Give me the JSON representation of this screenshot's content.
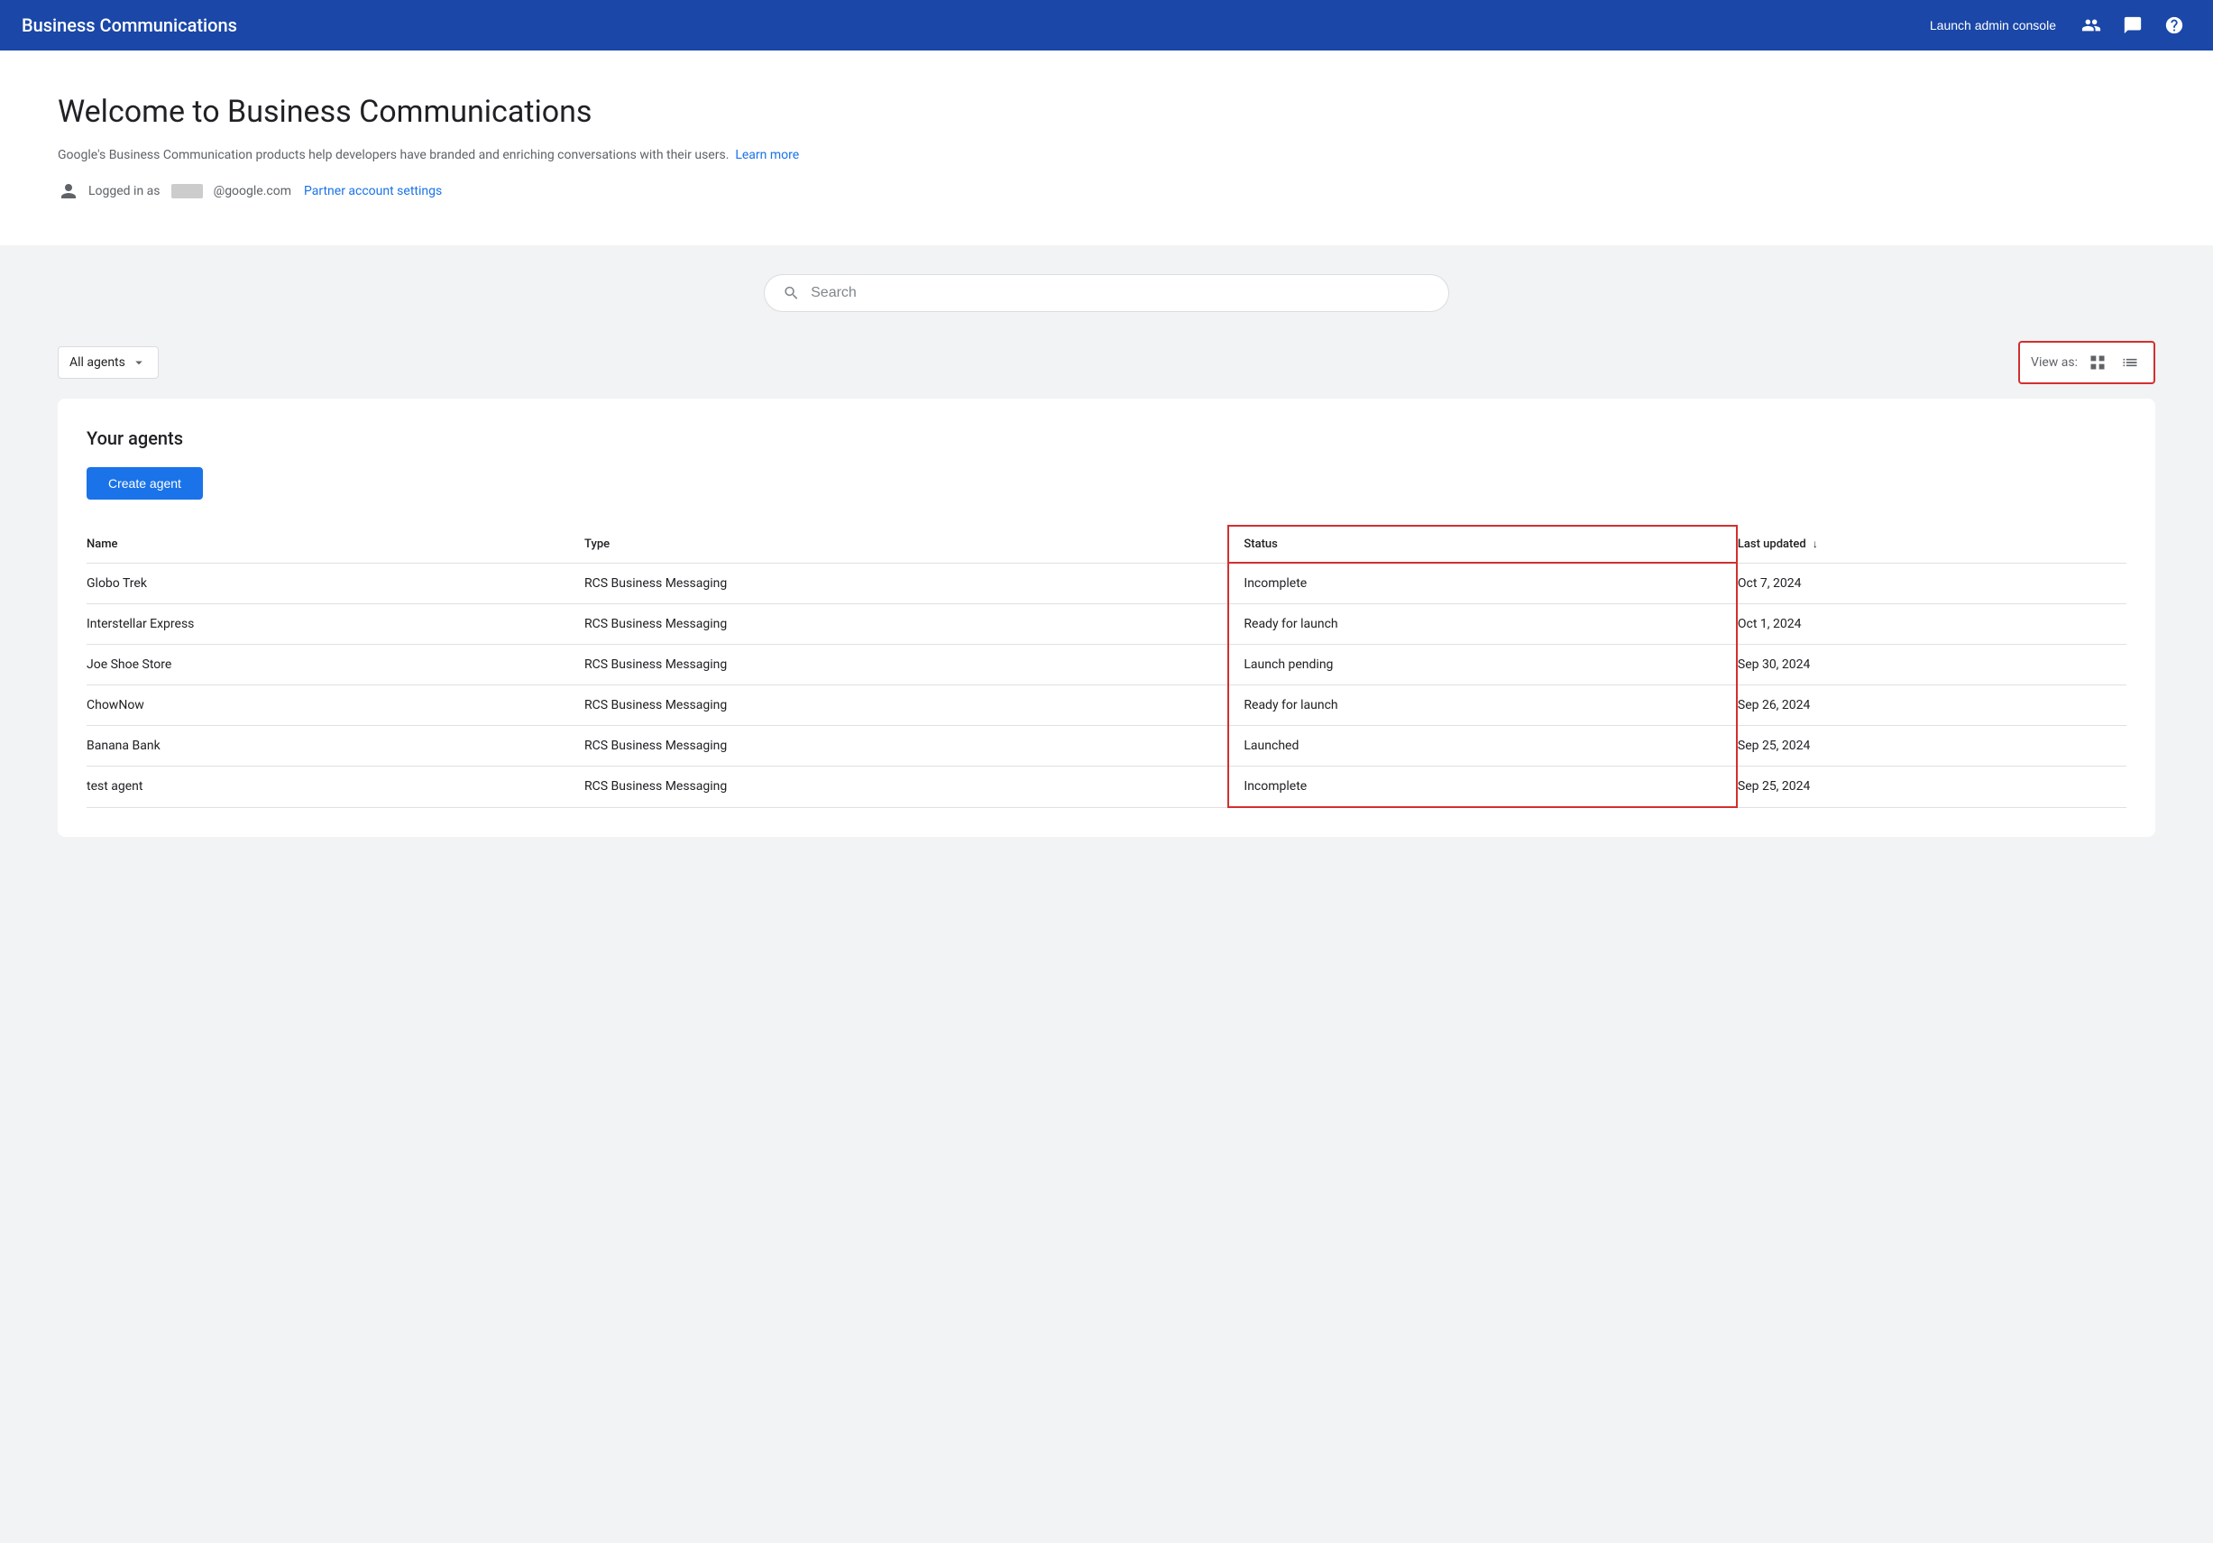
{
  "header": {
    "title": "Business Communications",
    "launch_btn": "Launch admin console",
    "icons": {
      "people": "👥",
      "chat": "💬",
      "help": "?"
    }
  },
  "welcome": {
    "title": "Welcome to Business Communications",
    "description": "Google's Business Communication products help developers have branded and enriching conversations with their users.",
    "learn_more": "Learn more",
    "logged_in_prefix": "Logged in as",
    "email_domain": "@google.com",
    "partner_settings": "Partner account settings"
  },
  "search": {
    "placeholder": "Search"
  },
  "filter": {
    "label": "All agents"
  },
  "view_as": {
    "label": "View as:"
  },
  "agents": {
    "title": "Your agents",
    "create_btn": "Create agent",
    "columns": {
      "name": "Name",
      "type": "Type",
      "status": "Status",
      "last_updated": "Last updated"
    },
    "rows": [
      {
        "name": "Globo Trek",
        "type": "RCS Business Messaging",
        "status": "Incomplete",
        "last_updated": "Oct 7, 2024"
      },
      {
        "name": "Interstellar Express",
        "type": "RCS Business Messaging",
        "status": "Ready for launch",
        "last_updated": "Oct 1, 2024"
      },
      {
        "name": "Joe Shoe Store",
        "type": "RCS Business Messaging",
        "status": "Launch pending",
        "last_updated": "Sep 30, 2024"
      },
      {
        "name": "ChowNow",
        "type": "RCS Business Messaging",
        "status": "Ready for launch",
        "last_updated": "Sep 26, 2024"
      },
      {
        "name": "Banana Bank",
        "type": "RCS Business Messaging",
        "status": "Launched",
        "last_updated": "Sep 25, 2024"
      },
      {
        "name": "test agent",
        "type": "RCS Business Messaging",
        "status": "Incomplete",
        "last_updated": "Sep 25, 2024"
      }
    ]
  }
}
